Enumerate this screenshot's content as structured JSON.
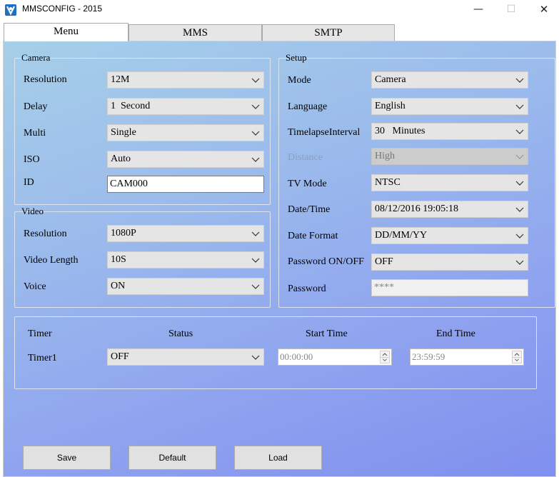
{
  "window": {
    "title": "MMSCONFIG - 2015",
    "min_glyph": "—",
    "max_glyph": "☐",
    "close_glyph": "✕"
  },
  "tabs": [
    {
      "label": "Menu"
    },
    {
      "label": "MMS"
    },
    {
      "label": "SMTP"
    }
  ],
  "camera": {
    "title": "Camera",
    "resolution": {
      "label": "Resolution",
      "value": "12M"
    },
    "delay": {
      "label": "Delay",
      "value": "1  Second"
    },
    "multi": {
      "label": "Multi",
      "value": "Single"
    },
    "iso": {
      "label": "ISO",
      "value": "Auto"
    },
    "id": {
      "label": "ID",
      "value": "CAM000"
    }
  },
  "video": {
    "title": "Video",
    "resolution": {
      "label": "Resolution",
      "value": "1080P"
    },
    "length": {
      "label": "Video Length",
      "value": "10S"
    },
    "voice": {
      "label": "Voice",
      "value": "ON"
    }
  },
  "setup": {
    "title": "Setup",
    "mode": {
      "label": "Mode",
      "value": "Camera"
    },
    "language": {
      "label": "Language",
      "value": "English"
    },
    "timelapse": {
      "label": "TimelapseInterval",
      "value": "30   Minutes"
    },
    "distance": {
      "label": "Distance",
      "value": "High"
    },
    "tv_mode": {
      "label": "TV Mode",
      "value": "NTSC"
    },
    "datetime": {
      "label": "Date/Time",
      "value": "08/12/2016 19:05:18"
    },
    "date_format": {
      "label": "Date Format",
      "value": "DD/MM/YY"
    },
    "password_onoff": {
      "label": "Password ON/OFF",
      "value": "OFF"
    },
    "password": {
      "label": "Password",
      "value": "****"
    }
  },
  "timer": {
    "headers": {
      "timer": "Timer",
      "status": "Status",
      "start": "Start Time",
      "end": "End Time"
    },
    "row": {
      "label": "Timer1",
      "status": "OFF",
      "start": "00:00:00",
      "end": "23:59:59"
    }
  },
  "buttons": {
    "save": "Save",
    "default": "Default",
    "load": "Load"
  }
}
